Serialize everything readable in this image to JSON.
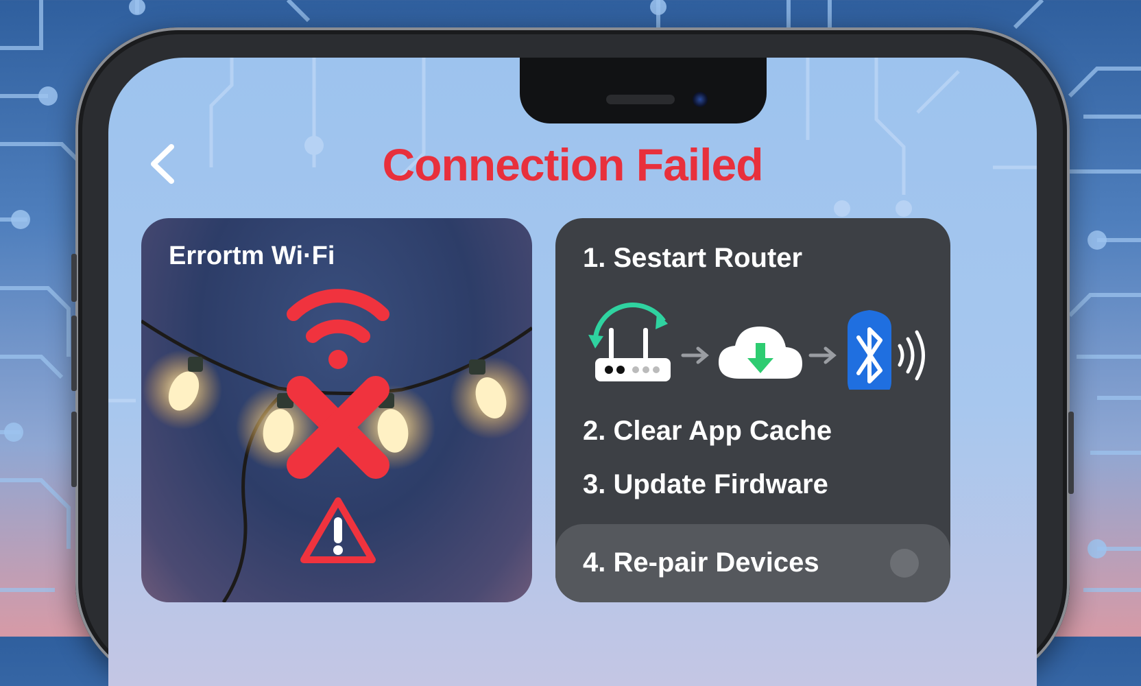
{
  "header": {
    "title": "Connection Failed",
    "back_icon": "chevron-left-icon"
  },
  "error_card": {
    "label": "Errortm Wi·Fi",
    "icons": [
      "wifi-icon",
      "cross-icon",
      "warning-icon"
    ],
    "accent_color": "#e8303c"
  },
  "steps_card": {
    "steps": [
      "1. Sestart Router",
      "2. Clear App Cache",
      "3. Update Firdware",
      "4. Re-pair Devices"
    ],
    "flow_icons": [
      "router-restart-icon",
      "arrow-right-icon",
      "cloud-download-icon",
      "arrow-right-icon",
      "bluetooth-icon",
      "signal-waves-icon"
    ]
  },
  "colors": {
    "title_red": "#e8303c",
    "card_dark": "#3d4045",
    "bluetooth_blue": "#1f6fe0",
    "download_green": "#2ecc71"
  }
}
